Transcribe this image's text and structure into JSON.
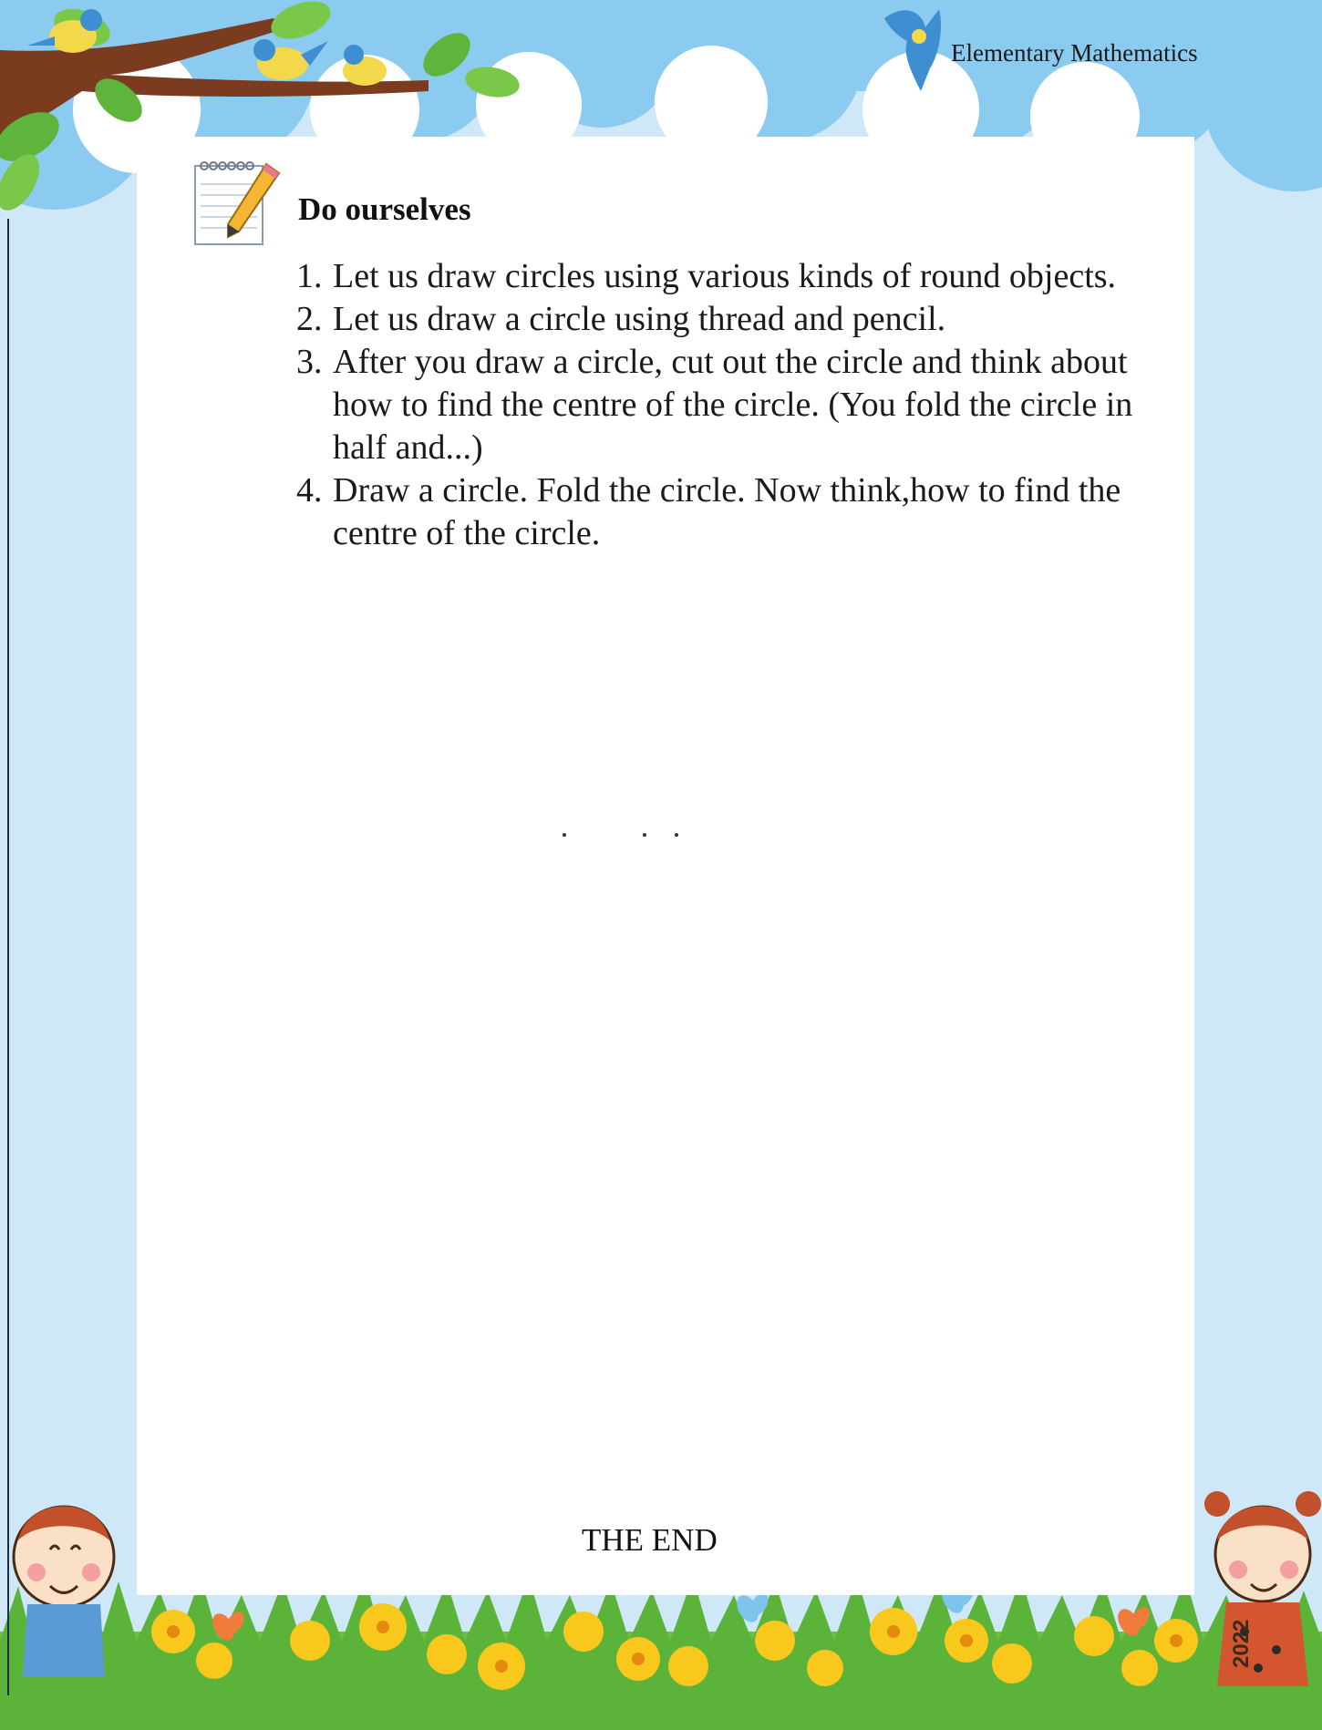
{
  "header": {
    "title": "Elementary Mathematics"
  },
  "section": {
    "title": "Do ourselves",
    "icon": "notepad-pencil-icon",
    "items": [
      {
        "number": "1.",
        "text": "Let us draw circles using various kinds of round objects."
      },
      {
        "number": "2.",
        "text": "Let us draw a circle using thread and pencil."
      },
      {
        "number": "3.",
        "text": "After you draw a circle, cut out the circle and think about how to find the centre of the circle. (You fold the circle in half and...)"
      },
      {
        "number": "4.",
        "text": "Draw a circle. Fold the circle. Now think,how to find the centre of the circle."
      }
    ]
  },
  "footer": {
    "end_text": "THE END",
    "year": "2022"
  },
  "colors": {
    "sky": "#c9e6f8",
    "cloud": "#7fc4ee",
    "grass": "#5cb33a",
    "flower": "#f8c81c"
  }
}
